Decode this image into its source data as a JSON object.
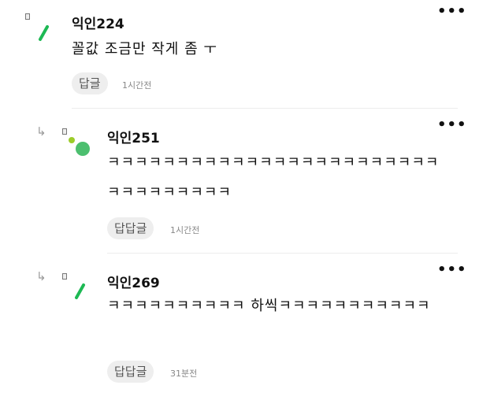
{
  "comments": [
    {
      "author": "익인224",
      "text": "꼴값 조금만 작게 좀 ㅜ",
      "reply_label": "답글",
      "time": "1시간전",
      "is_reply": false
    },
    {
      "author": "익인251",
      "text": "ㅋㅋㅋㅋㅋㅋㅋㅋㅋㅋㅋㅋㅋㅋㅋㅋㅋㅋㅋㅋㅋㅋㅋㅋㅋㅋㅋㅋㅋㅋㅋㅋㅋ",
      "reply_label": "답답글",
      "time": "1시간전",
      "is_reply": true
    },
    {
      "author": "익인269",
      "text": "ㅋㅋㅋㅋㅋㅋㅋㅋㅋㅋ 하씩ㅋㅋㅋㅋㅋㅋㅋㅋㅋㅋㅋ",
      "reply_label": "답답글",
      "time": "31분전",
      "is_reply": true
    }
  ],
  "more_label": "•••",
  "reply_arrow": "↳",
  "colors": {
    "avatar_green": "#1db954",
    "avatar_dot_green": "#4cbf6f",
    "avatar_dot_lime": "#9ccc2a",
    "button_bg": "#eeeeee"
  }
}
